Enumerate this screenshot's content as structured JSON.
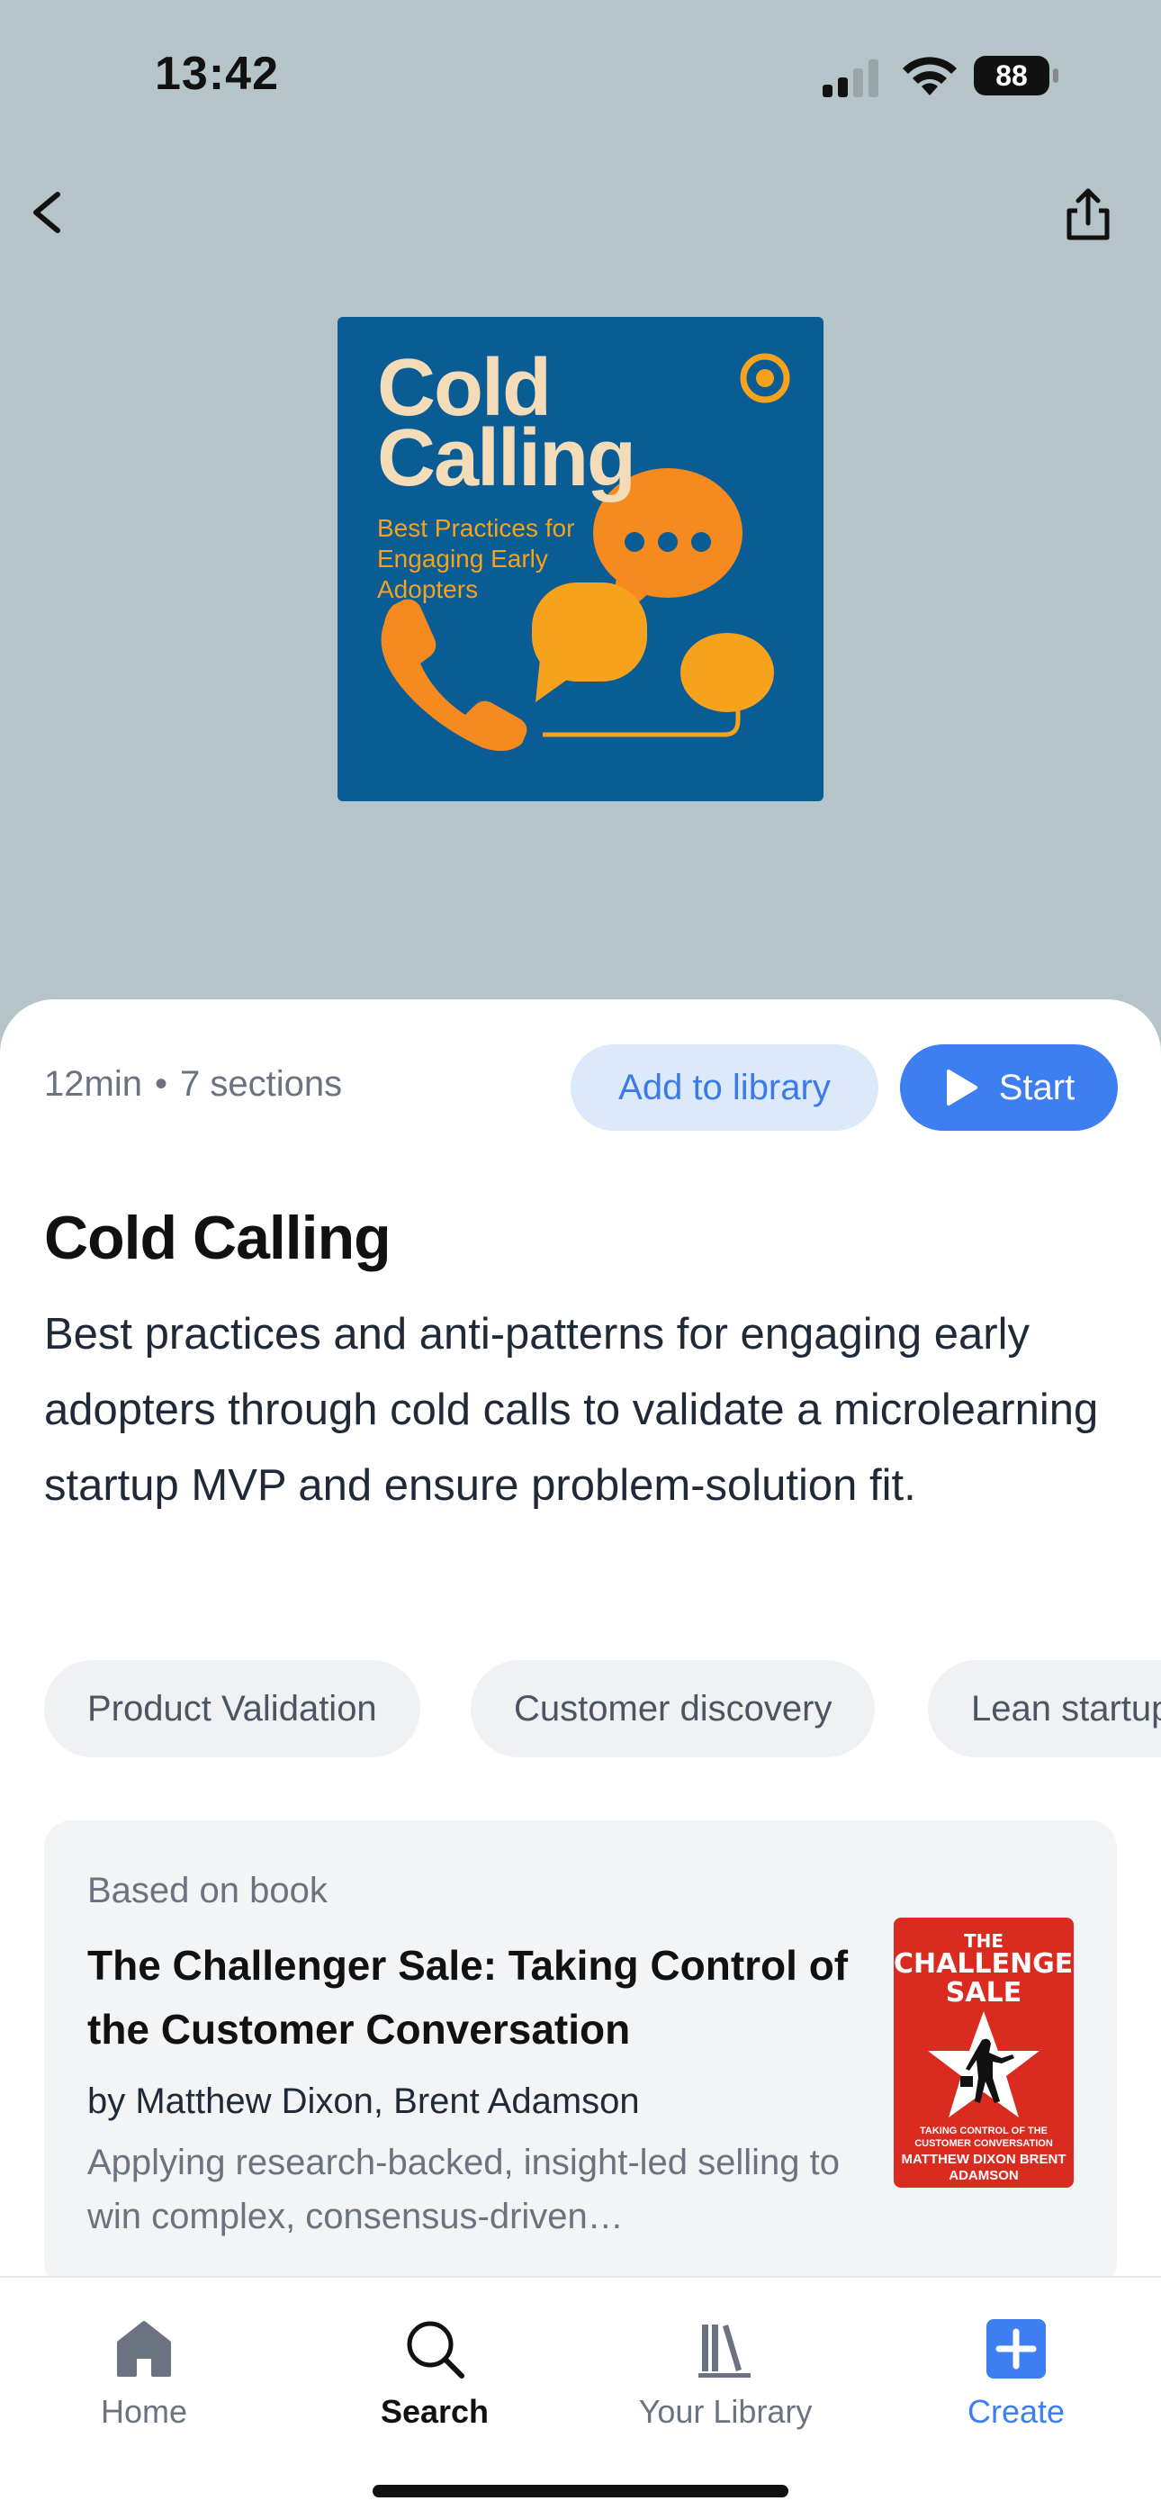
{
  "status_bar": {
    "time": "13:42",
    "battery": "88"
  },
  "nav": {
    "back_icon": "chevron-left-icon",
    "share_icon": "share-icon"
  },
  "cover": {
    "title_line1": "Cold",
    "title_line2": "Calling",
    "subtitle": "Best Practices for Engaging Early Adopters",
    "background": "#0a5c95",
    "accent": "#f6a21d"
  },
  "meta": {
    "duration": "12min",
    "separator": "•",
    "sections": "7 sections"
  },
  "actions": {
    "add_to_library": "Add to library",
    "start": "Start"
  },
  "content": {
    "title": "Cold Calling",
    "description": "Best practices and anti-patterns for engaging early adopters through cold calls to validate a microlearning startup MVP and ensure problem-solution fit."
  },
  "tags": [
    "Product Validation",
    "Customer discovery",
    "Lean startup"
  ],
  "book": {
    "label": "Based on book",
    "title": "The Challenger Sale: Taking Control of the Customer Conversation",
    "authors": "by Matthew Dixon, Brent Adamson",
    "summary": "Applying research-backed, insight-led selling to win complex, consensus-driven…",
    "cover_the": "THE",
    "cover_title": "CHALLENGER SALE",
    "cover_subtitle": "TAKING CONTROL OF THE CUSTOMER CONVERSATION",
    "cover_authors": "MATTHEW DIXON BRENT ADAMSON"
  },
  "tab_bar": {
    "home": "Home",
    "search": "Search",
    "library": "Your Library",
    "create": "Create",
    "active": "search"
  },
  "colors": {
    "primary": "#3d7ef0",
    "header_bg": "#b4c4c9"
  }
}
